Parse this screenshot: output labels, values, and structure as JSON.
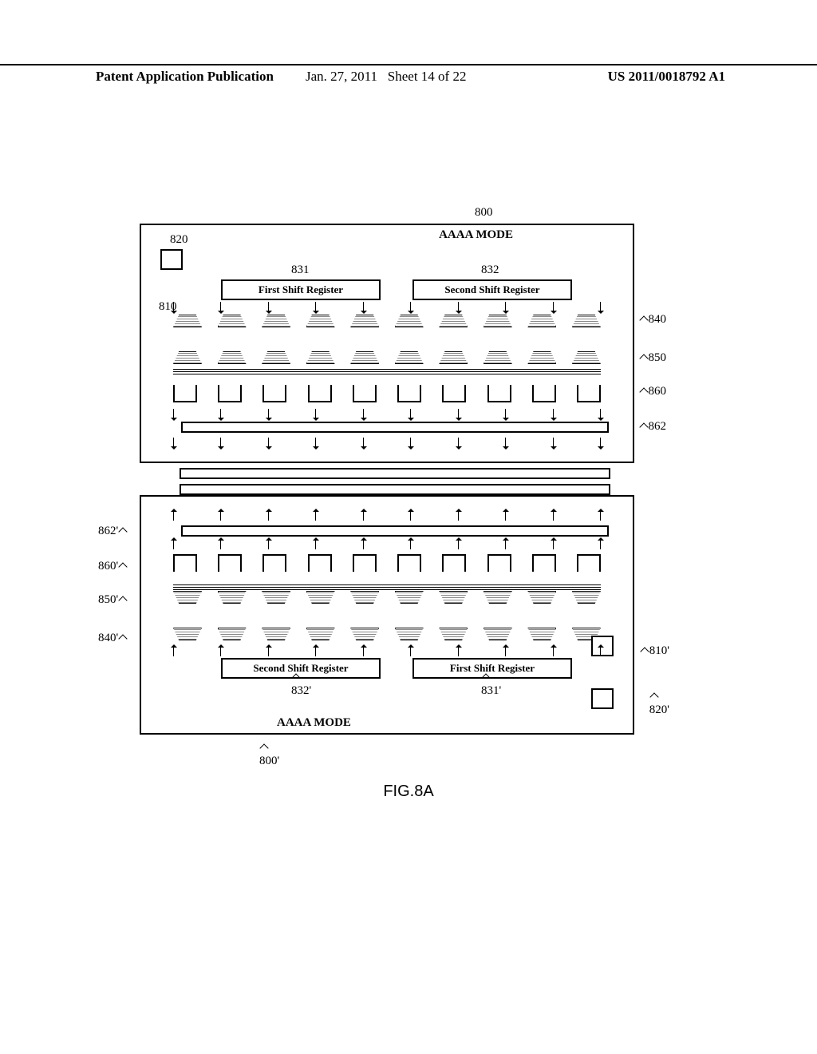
{
  "header": {
    "left": "Patent Application Publication",
    "date": "Jan. 27, 2011",
    "sheet": "Sheet 14 of 22",
    "pubno": "US 2011/0018792 A1"
  },
  "figure": {
    "caption": "FIG.8A",
    "mode_top": "AAAA MODE",
    "mode_bottom": "AAAA MODE",
    "sr1_label": "First Shift Register",
    "sr2_label": "Second Shift Register",
    "refs_top": {
      "r800": "800",
      "r820": "820",
      "r831": "831",
      "r832": "832",
      "r810": "810",
      "r840": "840",
      "r850": "850",
      "r860": "860",
      "r862": "862"
    },
    "refs_bottom": {
      "r800p": "800'",
      "r820p": "820'",
      "r831p": "831'",
      "r832p": "832'",
      "r810p": "810'",
      "r840p": "840'",
      "r850p": "850'",
      "r860p": "860'",
      "r862p": "862'"
    },
    "columns": 10
  }
}
